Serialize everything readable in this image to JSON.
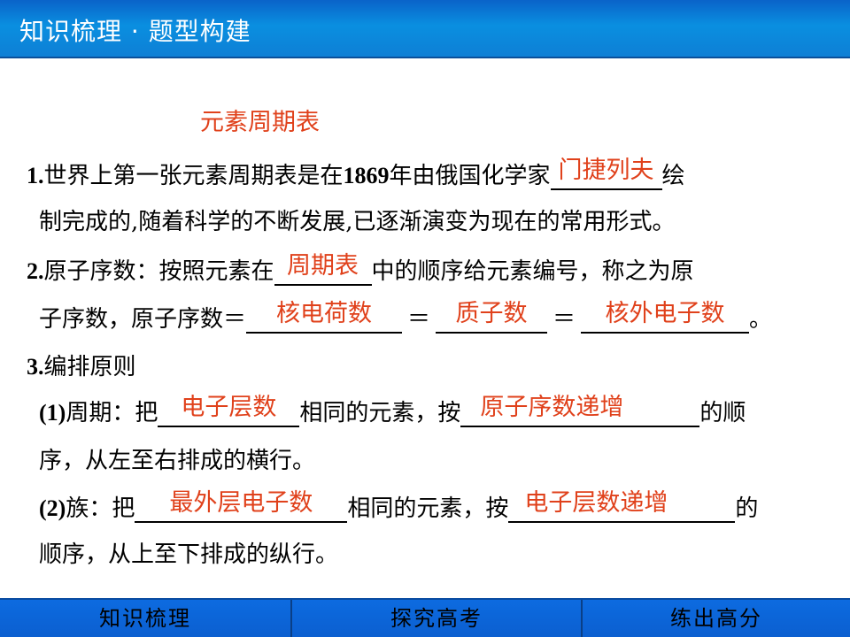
{
  "header": {
    "title": "知识梳理 · 题型构建"
  },
  "section": {
    "heading": "元素周期表"
  },
  "item1": {
    "num": "1.",
    "text_a": "世界上第一张元素周期表是在",
    "year": "1869",
    "text_b": "年由俄国化学家",
    "answer": "门捷列夫",
    "text_c": "绘",
    "line2": "制完成的,随着科学的不断发展,已逐渐演变为现在的常用形式。"
  },
  "item2": {
    "num": "2.",
    "text_a": "原子序数：按照元素在",
    "answer1": "周期表",
    "text_b": "中的顺序给元素编号，称之为原",
    "line2_a": "子序数，原子序数＝",
    "answer2": "核电荷数",
    "eq1": "＝",
    "answer3": "质子数",
    "eq2": "＝",
    "answer4": "核外电子数",
    "end": "。"
  },
  "item3": {
    "num": "3.",
    "text": "编排原则",
    "sub1": {
      "num": "(1)",
      "text_a": "周期：把",
      "answer1": "电子层数",
      "text_b": "相同的元素，按",
      "answer2": "原子序数递增",
      "text_c": "的顺",
      "line2": "序，从左至右排成的横行。"
    },
    "sub2": {
      "num": "(2)",
      "text_a": "族：把",
      "answer1": "最外层电子数",
      "text_b": "相同的元素，按",
      "answer2": "电子层数递增",
      "text_c": "的",
      "line2": "顺序，从上至下排成的纵行。"
    }
  },
  "footer": {
    "nav": [
      "知识梳理",
      "探究高考",
      "练出高分"
    ]
  }
}
